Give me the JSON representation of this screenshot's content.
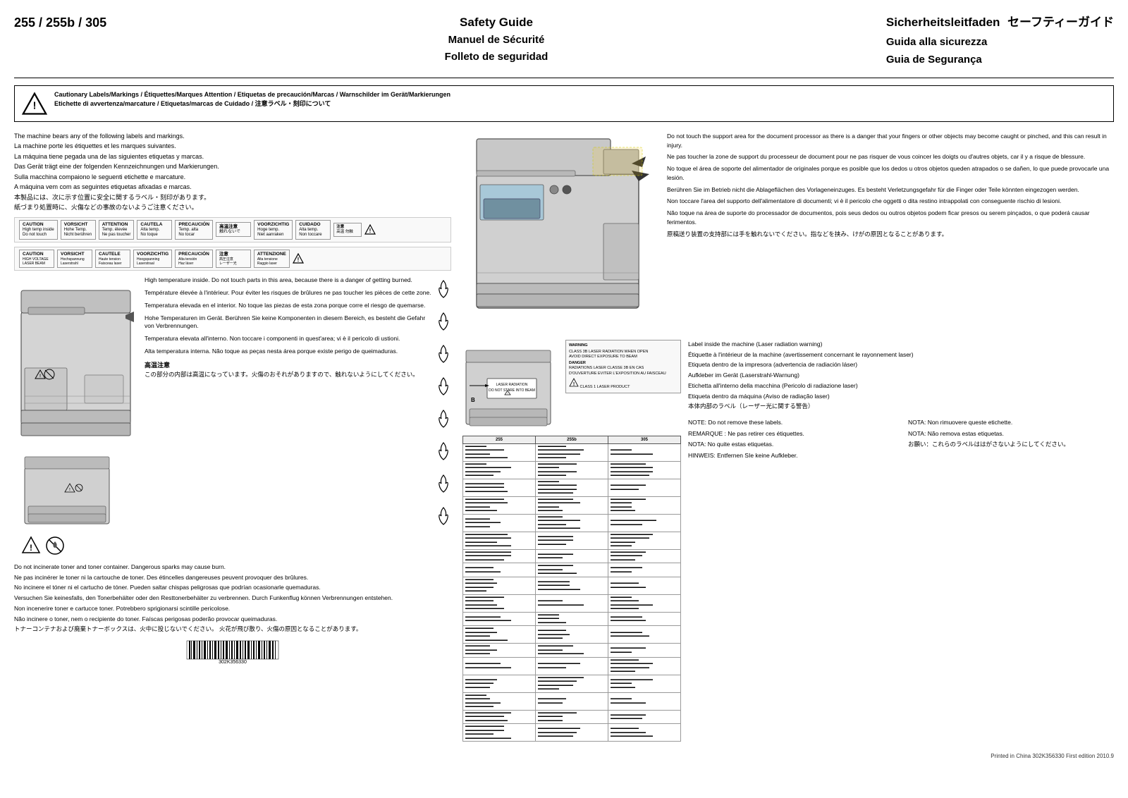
{
  "header": {
    "model": "255 / 255b / 305",
    "center_line1": "Safety Guide",
    "center_line2": "Manuel de Sécurité",
    "center_line3": "Folleto de seguridad",
    "right_line1": "Sicherheitsleitfaden",
    "right_line2": "セーフティーガイド",
    "right_line3": "Guida alla sicurezza",
    "right_line4": "Guia de Segurança"
  },
  "warning_banner": {
    "title_line1": "Cautionary Labels/Markings / Étiquettes/Marques Attention / Etiquetas de precaución/Marcas / Warnschilder im Gerät/Markierungen",
    "title_line2": "Etichette di avvertenza/marcature / Etiquetas/marcas de Cuidado / 注意ラベル・刻印について"
  },
  "left_intro": {
    "lines": [
      "The machine bears any of the following labels and markings.",
      "La machine porte les étiquettes et les marques suivantes.",
      "La máquina tiene pegada una de las siguientes etiquetas y marcas.",
      "Das Gerät trägt eine der folgenden Kennzeichnungen und Markierungen.",
      "Sulla macchina compaiono le seguenti etichette e marcature.",
      "A máquina vem com as seguintes etiquetas afixadas e marcas.",
      "本製品には、次に示す位置に安全に関するラベル・刻印があります。",
      "紙づまり処置時に、火傷などの事故のないようご注意ください。"
    ]
  },
  "temp_warnings": {
    "paragraphs": [
      "High temperature inside. Do not touch parts in this area, because there is a danger of getting burned.",
      "Température élevée à l'intérieur. Pour éviter les risques de brûlures ne pas toucher les pièces de cette zone.",
      "Temperatura elevada en el interior. No toque las piezas de esta zona porque corre el riesgo de quemarse.",
      "Hohe Temperaturen im Gerät. Berühren Sie keine Komponenten in diesem Bereich, es besteht die Gefahr von Verbrennungen.",
      "Temperatura elevata all'interno. Non toccare i componenti in quest'area; vi è il pericolo di ustioni.",
      "Alta temperatura interna. Não toque as peças nesta área porque existe perigo de queimaduras."
    ],
    "japanese_title": "高温注意",
    "japanese_text": "この部分の内部は高温になっています。火傷のおそれがありますので、触れないようにしてください。"
  },
  "toner_warning": {
    "lines": [
      "Do not incinerate toner and toner container. Dangerous sparks may cause burn.",
      "Ne pas incinérer le toner ni la cartouche de toner. Des étincelles dangereuses peuvent provoquer des brûlures.",
      "No incinere el tóner ni el cartucho de tóner. Pueden saltar chispas peligrosas que podrían ocasionarle quemaduras.",
      "Versuchen Sie keinesfalls, den Tonerbehälter oder den Resttonerbehälter zu verbrennen. Durch Funkenflug können Verbrennungen entstehen.",
      "Non incenerire toner e cartucce toner. Potrebbero sprigionarsi scintille pericolose.",
      "Não incinere o toner, nem o recipiente do toner. Faíscas perigosas poderão provocar queimaduras.",
      "トナーコンテナおよび廃棄トナーボックスは、火中に投じないでください。 火花が飛び散り、火傷の原因となることがあります。"
    ]
  },
  "right_top_text": {
    "paragraphs": [
      "Do not touch the support area for the document processor as there is a danger that your fingers or other objects may become caught or pinched, and this can result in injury.",
      "Ne pas toucher la zone de support du processeur de document pour ne pas risquer de vous coincer les doigts ou d'autres objets, car il y a risque de blessure.",
      "No toque el área de soporte del alimentador de originales porque es posible que los dedos u otros objetos queden atrapados o se dañen, lo que puede provocarle una lesión.",
      "Berühren Sie im Betrieb nicht die Ablageflächen des Vorlageneinzuges. Es besteht Verletzungsgefahr für die Finger oder Teile könnten eingezogen werden.",
      "Non toccare l'area del supporto dell'alimentatore di documenti; vi è il pericolo che oggetti o dita restino intrappolati con conseguente rischio di lesioni.",
      "Não toque na área de suporte do processador de documentos, pois seus dedos ou outros objetos podem ficar presos ou serem pinçados, o que poderá causar ferimentos.",
      "原稿送り装置の支持部には手を触れないでください。指などを挟み、けがの原因となることがあります。"
    ]
  },
  "laser_warning": {
    "lines": [
      "Label inside the machine (Laser radiation warning)",
      "Étiquette à l'intérieur de la machine (avertissement concernant le rayonnement laser)",
      "Etiqueta dentro de la impresora (advertencia de radiación láser)",
      "Aufkleber im Gerät (Laserstrahl-Warnung)",
      "Etichetta all'interno della macchina (Pericolo di radiazione laser)",
      "Etiqueta dentro da máquina (Aviso de radiação laser)",
      "本体内部のラベル（レーザー光に関する警告）"
    ]
  },
  "notes": {
    "items": [
      {
        "label": "NOTE: Do not remove these labels.",
        "col": 1
      },
      {
        "label": "NOTA: Non rimuovere queste etichette.",
        "col": 2
      },
      {
        "label": "REMARQUE : Ne pas retirer ces étiquettes.",
        "col": 1
      },
      {
        "label": "NOTA: Não remova estas etiquetas.",
        "col": 2
      },
      {
        "label": "NOTA: No quite estas etiquetas.",
        "col": 1
      },
      {
        "label": "お願い：これらのラベルははがさないようにしてください。",
        "col": 2
      },
      {
        "label": "HINWEIS: Entfernen SIe keine Aufkleber.",
        "col": 1
      }
    ]
  },
  "model_table": {
    "headers": [
      "255",
      "255b",
      "305"
    ],
    "rows": 18
  },
  "footer": {
    "text": "Printed in China  302K356330 First edition 2010.9"
  },
  "barcode": {
    "code": "302K356330"
  }
}
